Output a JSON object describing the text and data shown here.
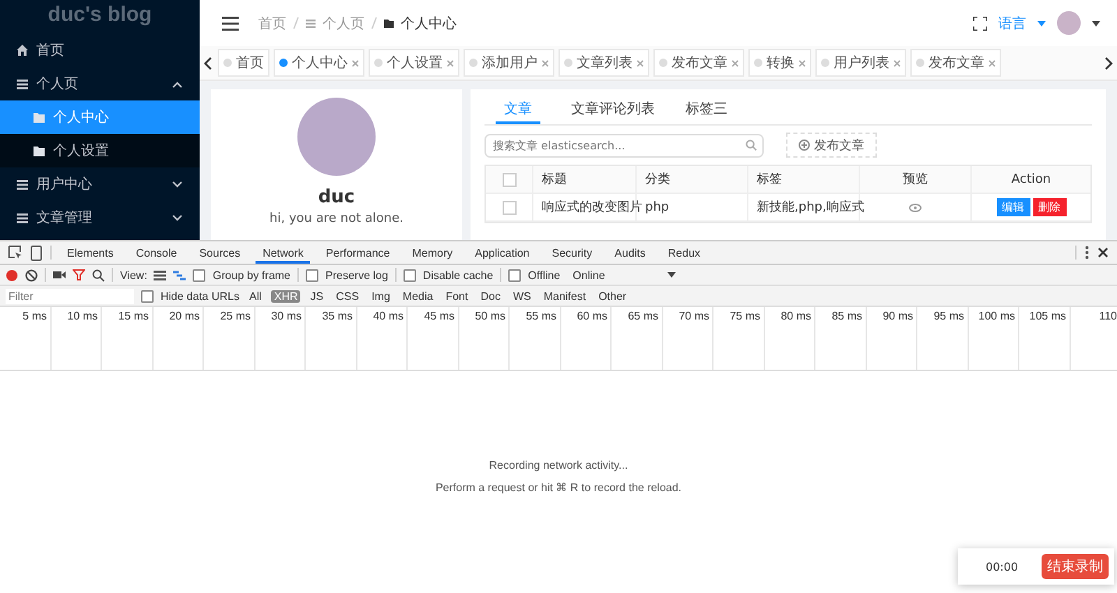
{
  "sidebar": {
    "title": "duc's blog",
    "items": [
      {
        "label": "首页",
        "kind": "home",
        "selected": false
      },
      {
        "label": "个人页",
        "kind": "group",
        "selected": false,
        "expanded": true,
        "children": [
          {
            "label": "个人中心",
            "selected": true
          },
          {
            "label": "个人设置",
            "selected": false
          }
        ]
      },
      {
        "label": "用户中心",
        "kind": "group",
        "selected": false,
        "expanded": false
      },
      {
        "label": "文章管理",
        "kind": "group",
        "selected": false,
        "expanded": false
      }
    ]
  },
  "header": {
    "breadcrumb": [
      "首页",
      "个人页",
      "个人中心"
    ],
    "language": "语言"
  },
  "page_tabs": [
    {
      "label": "首页",
      "selected": false,
      "closable": false
    },
    {
      "label": "个人中心",
      "selected": true,
      "closable": true
    },
    {
      "label": "个人设置",
      "selected": false,
      "closable": true
    },
    {
      "label": "添加用户",
      "selected": false,
      "closable": true
    },
    {
      "label": "文章列表",
      "selected": false,
      "closable": true
    },
    {
      "label": "发布文章",
      "selected": false,
      "closable": true
    },
    {
      "label": "转换",
      "selected": false,
      "closable": true
    },
    {
      "label": "用户列表",
      "selected": false,
      "closable": true
    },
    {
      "label": "发布文章",
      "selected": false,
      "closable": true
    }
  ],
  "profile": {
    "name": "duc",
    "bio": "hi, you are not alone."
  },
  "content_tabs": [
    {
      "label": "文章",
      "selected": true
    },
    {
      "label": "文章评论列表",
      "selected": false
    },
    {
      "label": "标签三",
      "selected": false
    }
  ],
  "search": {
    "placeholder": "搜索文章 elasticsearch..."
  },
  "publish_button": "发布文章",
  "table": {
    "all_checked": false,
    "columns": [
      "标题",
      "分类",
      "标签",
      "预览",
      "Action"
    ],
    "rows": [
      {
        "checked": false,
        "title": "响应式的改变图片",
        "category": "php",
        "tags": "新技能,php,响应式",
        "actions": [
          "编辑",
          "删除"
        ]
      }
    ]
  },
  "devtools": {
    "tabs": [
      {
        "label": "Elements",
        "selected": false
      },
      {
        "label": "Console",
        "selected": false
      },
      {
        "label": "Sources",
        "selected": false
      },
      {
        "label": "Network",
        "selected": true
      },
      {
        "label": "Performance",
        "selected": false
      },
      {
        "label": "Memory",
        "selected": false
      },
      {
        "label": "Application",
        "selected": false
      },
      {
        "label": "Security",
        "selected": false
      },
      {
        "label": "Audits",
        "selected": false
      },
      {
        "label": "Redux",
        "selected": false
      }
    ],
    "recording": true,
    "view_label": "View:",
    "options": [
      {
        "label": "Group by frame",
        "checked": false
      },
      {
        "label": "Preserve log",
        "checked": false
      },
      {
        "label": "Disable cache",
        "checked": false
      },
      {
        "label": "Offline",
        "checked": false
      }
    ],
    "throttle": "Online",
    "filter_placeholder": "Filter",
    "hide_data_urls": {
      "label": "Hide data URLs",
      "checked": false
    },
    "types": [
      {
        "label": "All",
        "selected": false
      },
      {
        "label": "XHR",
        "selected": true
      },
      {
        "label": "JS",
        "selected": false
      },
      {
        "label": "CSS",
        "selected": false
      },
      {
        "label": "Img",
        "selected": false
      },
      {
        "label": "Media",
        "selected": false
      },
      {
        "label": "Font",
        "selected": false
      },
      {
        "label": "Doc",
        "selected": false
      },
      {
        "label": "WS",
        "selected": false
      },
      {
        "label": "Manifest",
        "selected": false
      },
      {
        "label": "Other",
        "selected": false
      }
    ],
    "ticks": [
      "5 ms",
      "10 ms",
      "15 ms",
      "20 ms",
      "25 ms",
      "30 ms",
      "35 ms",
      "40 ms",
      "45 ms",
      "50 ms",
      "55 ms",
      "60 ms",
      "65 ms",
      "70 ms",
      "75 ms",
      "80 ms",
      "85 ms",
      "90 ms",
      "95 ms",
      "100 ms",
      "105 ms",
      "110"
    ],
    "messages": [
      "Recording network activity...",
      "Perform a request or hit ⌘ R to record the reload."
    ]
  },
  "recorder": {
    "time": "00:00",
    "button": "结束录制"
  }
}
